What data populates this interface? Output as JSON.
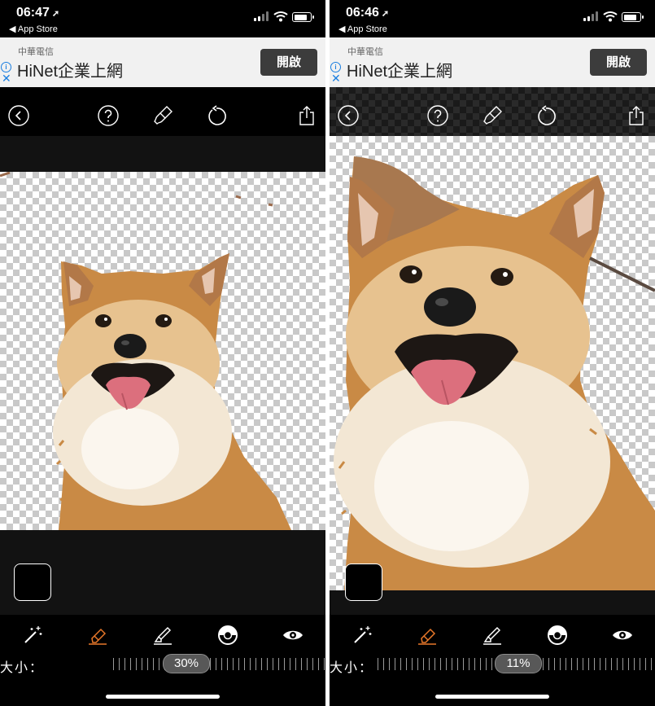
{
  "screens": [
    {
      "status": {
        "time": "06:47",
        "back_app": "◀ App Store"
      },
      "ad": {
        "sponsor": "中華電信",
        "title": "HiNet企業上網",
        "button": "開啟"
      },
      "size": {
        "label": "大小：",
        "value": "30%",
        "fraction": 0.3
      }
    },
    {
      "status": {
        "time": "06:46",
        "back_app": "◀ App Store"
      },
      "ad": {
        "sponsor": "中華電信",
        "title": "HiNet企業上網",
        "button": "開啟"
      },
      "size": {
        "label": "大小：",
        "value": "11%",
        "fraction": 0.11
      }
    }
  ],
  "icons": {
    "toolbar": [
      "back-icon",
      "help-icon",
      "brush-icon",
      "undo-icon",
      "share-icon"
    ],
    "tools": [
      "magic-wand-icon",
      "eraser-icon",
      "restore-brush-icon",
      "lasso-icon",
      "preview-eye-icon"
    ]
  },
  "colors": {
    "accent": "#e8782a",
    "background": "#000000",
    "ad_button": "#3c3c3c"
  }
}
